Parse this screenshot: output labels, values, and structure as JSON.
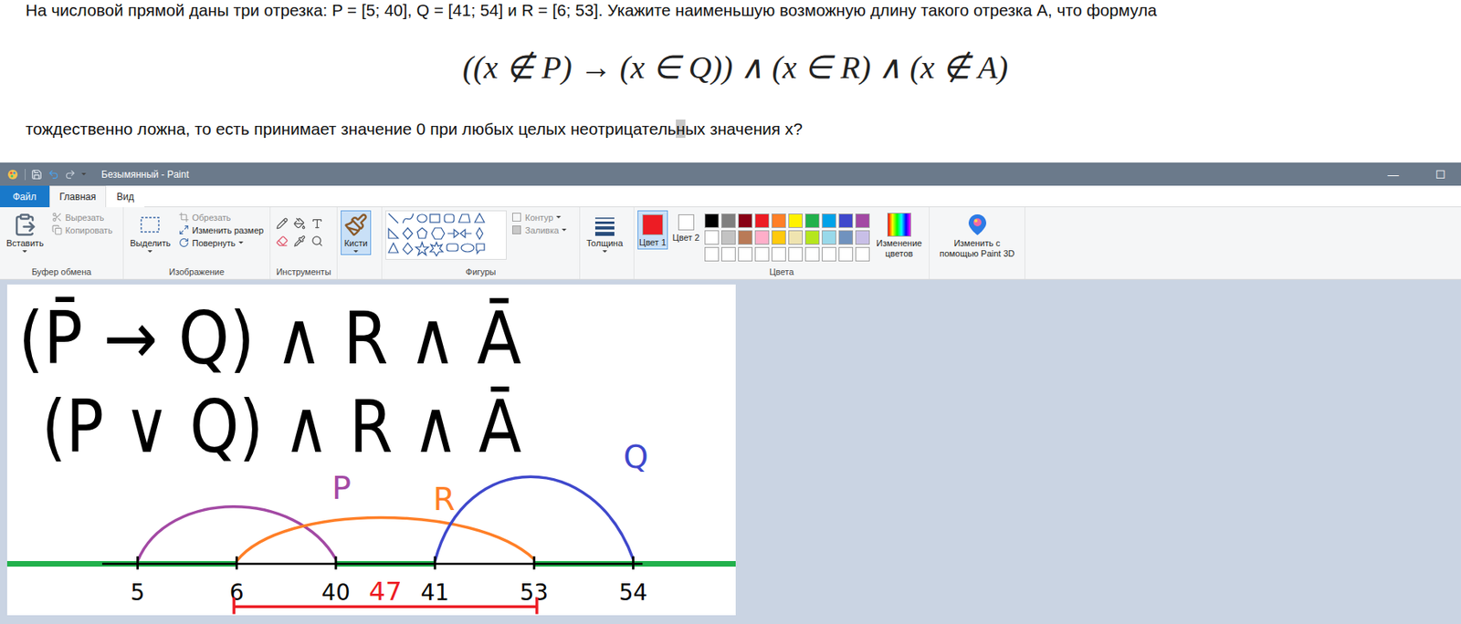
{
  "problem": {
    "intro": "На числовой прямой даны три отрезка: P = [5; 40], Q = [41; 54] и R = [6; 53]. Укажите наименьшую возможную длину такого отрезка A, что формула",
    "formula": "((x ∉ P) → (x ∈ Q)) ∧ (x ∈ R) ∧ (x ∉ A)",
    "outro": [
      {
        "text": "тождественно ложна, то есть принимает значение 0 при любых целых неотрицатель",
        "highlighted": false
      },
      {
        "text": "н",
        "highlighted": true
      },
      {
        "text": "ых значения x?",
        "highlighted": false
      }
    ]
  },
  "window": {
    "title": "Безымянный - Paint",
    "controls": [
      "—",
      "☐"
    ]
  },
  "tabs": [
    {
      "label": "Файл",
      "selected": false,
      "kind": "file"
    },
    {
      "label": "Главная",
      "selected": true,
      "kind": "tab"
    },
    {
      "label": "Вид",
      "selected": false,
      "kind": "tab"
    }
  ],
  "ribbon": {
    "clipboard": {
      "label": "Буфер обмена",
      "paste": "Вставить",
      "items": [
        {
          "label": "Вырезать",
          "disabled": true
        },
        {
          "label": "Копировать",
          "disabled": true
        }
      ]
    },
    "image": {
      "label": "Изображение",
      "select": "Выделить",
      "items": [
        {
          "label": "Обрезать",
          "disabled": true
        },
        {
          "label": "Изменить размер",
          "disabled": false
        },
        {
          "label": "Повернуть",
          "disabled": false
        }
      ]
    },
    "tools": {
      "label": "Инструменты"
    },
    "brushes": {
      "label": "Кисти",
      "selected": true
    },
    "shapes": {
      "label": "Фигуры",
      "items": [
        {
          "label": "Контур",
          "disabled": true
        },
        {
          "label": "Заливка",
          "disabled": true
        }
      ]
    },
    "size": {
      "label": "Толщина"
    },
    "colors": {
      "label": "Цвета",
      "slots": [
        {
          "label": "Цвет 1",
          "color": "#ed1c24",
          "selected": true
        },
        {
          "label": "Цвет 2",
          "color": "#ffffff",
          "selected": false
        }
      ],
      "palette": [
        "#000000",
        "#7f7f7f",
        "#880015",
        "#ed1c24",
        "#ff7f27",
        "#fff200",
        "#22b14c",
        "#00a2e8",
        "#3f48cc",
        "#a349a4",
        "#ffffff",
        "#c3c3c3",
        "#b97a57",
        "#ffaec9",
        "#ffc90e",
        "#efe4b0",
        "#b5e61d",
        "#99d9ea",
        "#7092be",
        "#c8bfe7"
      ],
      "custom_slots": 10,
      "edit": "Изменение цветов"
    },
    "paint3d": "Изменить с помощью Paint 3D"
  },
  "canvas": {
    "formulas": [
      "(P̄ → Q) ∧ R ∧ Ā",
      "(P ∨ Q) ∧ R ∧ Ā"
    ],
    "ticks": [
      {
        "label": "5"
      },
      {
        "label": "6"
      },
      {
        "label": "40"
      },
      {
        "label": "41"
      },
      {
        "label": "53"
      },
      {
        "label": "54"
      }
    ],
    "arcs": [
      {
        "label": "P",
        "from": "5",
        "to": "40",
        "color": "#a349a4"
      },
      {
        "label": "R",
        "from": "6",
        "to": "53",
        "color": "#ff7f27"
      },
      {
        "label": "Q",
        "from": "41",
        "to": "54",
        "color": "#3f48cc"
      }
    ],
    "highlight": {
      "color": "#22b14c",
      "ranges": [
        {
          "from": "start",
          "to": "6"
        },
        {
          "from": "40",
          "to": "41"
        },
        {
          "from": "53",
          "to": "end"
        }
      ]
    },
    "answer": {
      "label": "47",
      "from": "6",
      "to": "53",
      "between": [
        "40",
        "41"
      ],
      "color": "#ed1c24"
    }
  }
}
